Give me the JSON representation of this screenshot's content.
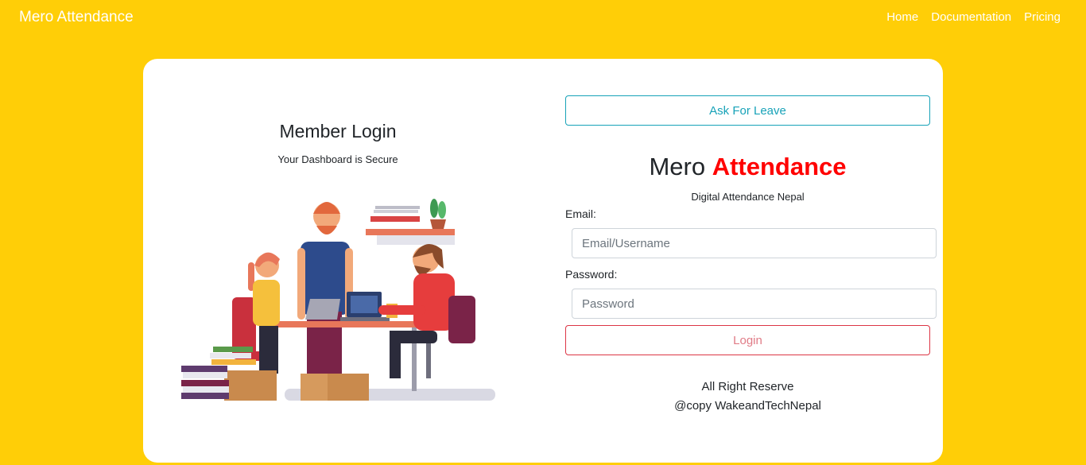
{
  "nav": {
    "brand": "Mero Attendance",
    "links": [
      "Home",
      "Documentation",
      "Pricing"
    ]
  },
  "login_panel": {
    "title": "Member Login",
    "subtitle": "Your Dashboard is Secure",
    "illustration": "team-working-illustration"
  },
  "form": {
    "leave_button": "Ask For Leave",
    "title_part1": "Mero",
    "title_part2": "Attendance",
    "subtitle": "Digital Attendance Nepal",
    "email_label": "Email:",
    "email_placeholder": "Email/Username",
    "password_label": "Password:",
    "password_placeholder": "Password",
    "login_button": "Login"
  },
  "footer": {
    "line1": "All Right Reserve",
    "line2": "@copy WakeandTechNepal"
  },
  "colors": {
    "background": "#ffce07",
    "accent_red": "#ff0000",
    "info": "#17a2b8",
    "danger": "#dc3545"
  }
}
